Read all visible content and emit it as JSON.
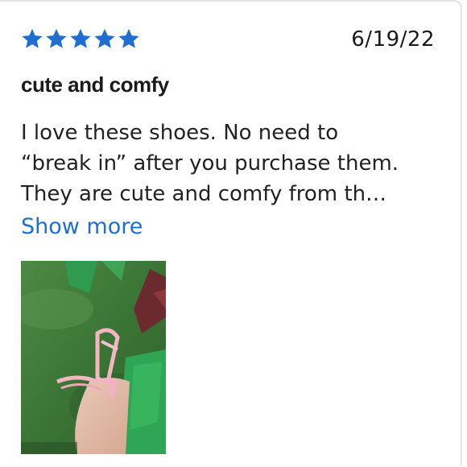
{
  "review": {
    "rating": 5,
    "rating_max": 5,
    "star_color": "#1f6fd1",
    "date": "6/19/22",
    "title": "cute and comfy",
    "body_lines": [
      "I love these shoes. No need to",
      "“break in” after you purchase them.",
      "They are cute and comfy from th…"
    ],
    "show_more_label": "Show more",
    "link_color": "#1f6fd1",
    "photo_icon": "review-photo-pink-heeled-sandal"
  }
}
